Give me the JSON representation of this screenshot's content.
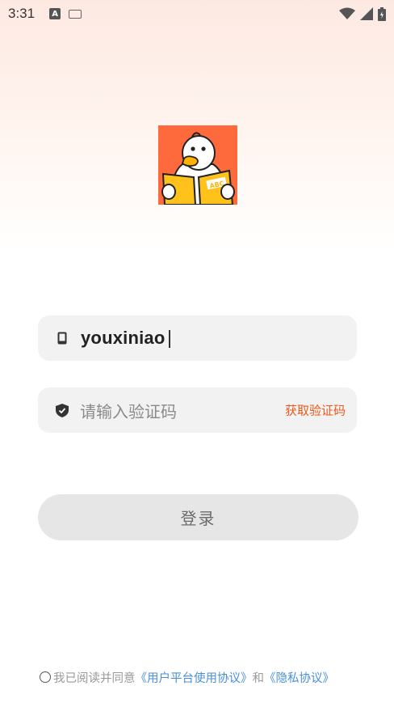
{
  "status_bar": {
    "time": "3:31",
    "left_icons": [
      "a-notification-icon",
      "keyboard-icon"
    ],
    "right_icons": [
      "wifi-icon",
      "signal-icon",
      "battery-icon"
    ]
  },
  "logo": {
    "name": "duck-reading-book-logo",
    "book_text": "ABC"
  },
  "phone_field": {
    "icon": "phone-icon",
    "value": "youxiniao"
  },
  "code_field": {
    "icon": "shield-icon",
    "placeholder": "请输入验证码",
    "get_code_label": "获取验证码"
  },
  "login_button": {
    "label": "登录"
  },
  "agreement": {
    "prefix": "我已阅读并同意",
    "user_agreement": "《用户平台使用协议》",
    "and": "和",
    "privacy": "《隐私协议》"
  },
  "colors": {
    "accent": "#e8591a",
    "link": "#4a90d9",
    "logo_bg": "#ff6a3d",
    "button_bg": "#e6e6e6",
    "field_bg": "#f2f2f2"
  }
}
